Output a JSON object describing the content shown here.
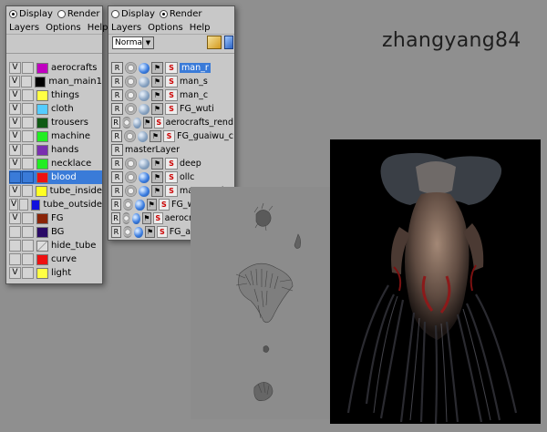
{
  "watermark": "zhangyang84",
  "display_panel": {
    "radio_display": "Display",
    "radio_render": "Render",
    "selected_radio": "Display",
    "menu": [
      "Layers",
      "Options",
      "Help"
    ],
    "layers": [
      {
        "name": "aerocrafts",
        "visible": "V",
        "color": "#c000c0"
      },
      {
        "name": "man_main1",
        "visible": "V",
        "color": "#000000"
      },
      {
        "name": "things",
        "visible": "V",
        "color": "#ffff44"
      },
      {
        "name": "cloth",
        "visible": "V",
        "color": "#55ccff"
      },
      {
        "name": "trousers",
        "visible": "V",
        "color": "#0f5a14"
      },
      {
        "name": "machine",
        "visible": "V",
        "color": "#22ee22"
      },
      {
        "name": "hands",
        "visible": "V",
        "color": "#7a2fb0"
      },
      {
        "name": "necklace",
        "visible": "V",
        "color": "#22ee22"
      },
      {
        "name": "blood",
        "visible": "",
        "color": "#ee1111",
        "selected": true
      },
      {
        "name": "tube_inside",
        "visible": "V",
        "color": "#ffff22"
      },
      {
        "name": "tube_outside",
        "visible": "V",
        "color": "#1111dd"
      },
      {
        "name": "FG",
        "visible": "V",
        "color": "#8a2408"
      },
      {
        "name": "BG",
        "visible": "",
        "color": "#2a0a66"
      },
      {
        "name": "hide_tube",
        "visible": "",
        "color": "hatch"
      },
      {
        "name": "curve",
        "visible": "",
        "color": "#ee1111"
      },
      {
        "name": "light",
        "visible": "V",
        "color": "#ffff44"
      }
    ]
  },
  "render_panel": {
    "radio_display": "Display",
    "radio_render": "Render",
    "selected_radio": "Render",
    "menu": [
      "Layers",
      "Options",
      "Help"
    ],
    "blend_mode": "Normal",
    "layers": [
      {
        "name": "man_r",
        "selected": true,
        "ball": "blue"
      },
      {
        "name": "man_s",
        "ball": "grey"
      },
      {
        "name": "man_c",
        "ball": "grey"
      },
      {
        "name": "FG_wuti",
        "ball": "grey"
      },
      {
        "name": "aerocrafts_rend",
        "ball": "grey"
      },
      {
        "name": "FG_guaiwu_c",
        "ball": "grey"
      },
      {
        "name": "masterLayer",
        "master": true
      },
      {
        "name": "deep",
        "ball": "grey"
      },
      {
        "name": "ollc",
        "ball": "blue"
      },
      {
        "name": "man_mask",
        "ball": "blue"
      },
      {
        "name": "FG_wuti_mask",
        "ball": "blue"
      },
      {
        "name": "aerocrafts_masl",
        "ball": "blue"
      },
      {
        "name": "FG_aerocrafts_",
        "ball": "blue"
      }
    ]
  }
}
